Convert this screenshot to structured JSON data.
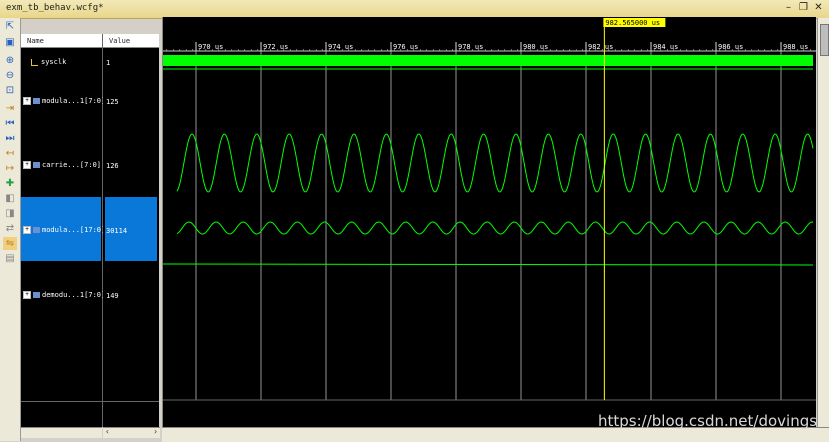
{
  "window": {
    "title": "exm_tb_behav.wcfg*"
  },
  "columns": {
    "name": "Name",
    "value": "Value"
  },
  "signals": [
    {
      "name": "sysclk",
      "value": "1",
      "kind": "clock"
    },
    {
      "name": "modula...1[7:0]",
      "value": "125",
      "kind": "bus"
    },
    {
      "name": "carrie...[7:0]",
      "value": "126",
      "kind": "bus"
    },
    {
      "name": "modula...[17:0]",
      "value": "30114",
      "kind": "bus",
      "selected": true
    },
    {
      "name": "demodu...1[7:0]",
      "value": "149",
      "kind": "bus"
    }
  ],
  "timeline": {
    "unit": "us",
    "ticks": [
      "970 us",
      "972 us",
      "974 us",
      "976 us",
      "978 us",
      "980 us",
      "982 us",
      "984 us",
      "986 us",
      "988 us"
    ],
    "cursor_label": "982.565000 us",
    "cursor_time": 982.565
  },
  "colors": {
    "wave": "#00ff00",
    "cursor": "#ffff00",
    "selection": "#0a78d8",
    "grid": "#bbbbbb"
  },
  "watermark": "https://blog.csdn.net/dovings"
}
